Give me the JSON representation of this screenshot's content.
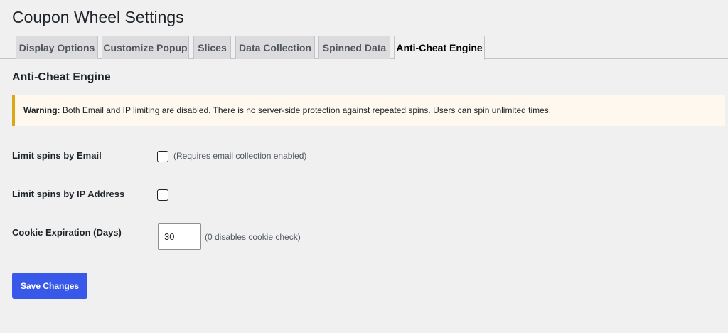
{
  "page": {
    "title": "Coupon Wheel Settings"
  },
  "tabs": [
    {
      "label": "Display Options",
      "active": false
    },
    {
      "label": "Customize Popup",
      "active": false
    },
    {
      "label": "Slices",
      "active": false
    },
    {
      "label": "Data Collection",
      "active": false
    },
    {
      "label": "Spinned Data",
      "active": false
    },
    {
      "label": "Anti-Cheat Engine",
      "active": true
    }
  ],
  "section": {
    "title": "Anti-Cheat Engine"
  },
  "notice": {
    "prefix": "Warning:",
    "message": "Both Email and IP limiting are disabled. There is no server-side protection against repeated spins. Users can spin unlimited times.",
    "border_color": "#dba617"
  },
  "settings": {
    "email_limit": {
      "label": "Limit spins by Email",
      "checked": false,
      "hint": "(Requires email collection enabled)"
    },
    "ip_limit": {
      "label": "Limit spins by IP Address",
      "checked": false
    },
    "cookie_expiration": {
      "label": "Cookie Expiration (Days)",
      "value": "30",
      "hint": "(0 disables cookie check)"
    }
  },
  "actions": {
    "save_label": "Save Changes",
    "accent_color": "#3858e9"
  }
}
